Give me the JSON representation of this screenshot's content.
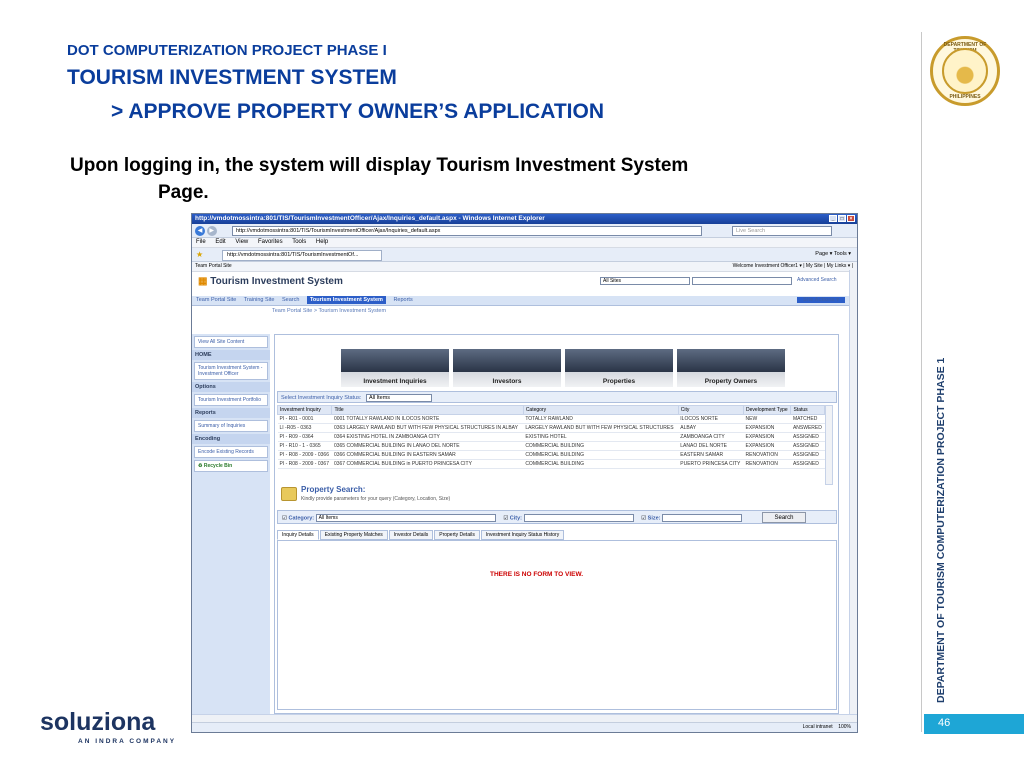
{
  "slide": {
    "heading1": "DOT COMPUTERIZATION PROJECT PHASE I",
    "heading2": "TOURISM INVESTMENT SYSTEM",
    "heading3": "> APPROVE PROPERTY OWNER’S APPLICATION",
    "intro_line1": "Upon logging in, the system will display Tourism Investment System",
    "intro_line2": "Page.",
    "side_text": "DEPARTMENT OF TOURISM COMPUTERIZATION PROJECT PHASE 1",
    "page_number": "46",
    "logo": "soluziona",
    "logo_sub": "AN INDRA COMPANY",
    "seal_top": "DEPARTMENT OF TOURISM",
    "seal_bottom": "PHILIPPINES"
  },
  "browser": {
    "title": "http://vmdotmossintra:801/TIS/TourismInvestmentOfficer/Ajax/Inquiries_default.aspx - Windows Internet Explorer",
    "url": "http://vmdotmossintra:801/TIS/TourismInvestmentOfficer/Ajax/Inquiries_default.aspx",
    "live_search": "Live Search",
    "menu": [
      "File",
      "Edit",
      "View",
      "Favorites",
      "Tools",
      "Help"
    ],
    "tab": "http://vmdotmossintra:801/TIS/TourismInvestmentOf...",
    "tools_right": "Page ▾   Tools ▾",
    "status_zone": "Local intranet",
    "zoom": "100%"
  },
  "sharepoint": {
    "site": "Team Portal Site",
    "welcome": "Welcome Investment Officer1 ▾ | My Site | My Links ▾ |",
    "title": "Tourism Investment System",
    "all_sites": "All Sites",
    "advanced_search": "Advanced Search",
    "nav": [
      "Team Portal Site",
      "Training Site",
      "Search",
      "Tourism Investment System",
      "Reports"
    ],
    "site_actions": "Site Actions ▾",
    "breadcrumb": "Team Portal Site > Tourism Investment System"
  },
  "leftnav": {
    "view_all": "View All Site Content",
    "home": "HOME",
    "home_item": "Tourism Investment System - Investment Officer",
    "options": "Options",
    "options_item": "Tourism Investment Portfolio",
    "reports": "Reports",
    "reports_item": "Summary of Inquiries",
    "encoding": "Encoding",
    "encoding_item": "Encode Existing Records",
    "recycle": "Recycle Bin"
  },
  "tiles": [
    "Investment Inquiries",
    "Investors",
    "Properties",
    "Property Owners"
  ],
  "status_select": {
    "label": "Select Investment Inquiry Status:",
    "value": "All Items"
  },
  "grid": {
    "headers": [
      "Investment Inquiry",
      "Title",
      "Category",
      "City",
      "Development Type",
      "Status"
    ],
    "rows": [
      [
        "PI - R01 - 0001",
        "0001 TOTALLY RAWLAND IN ILOCOS NORTE",
        "TOTALLY RAWLAND",
        "ILOCOS NORTE",
        "NEW",
        "MATCHED"
      ],
      [
        "LI -R05 - 0363",
        "0363 LARGELY RAWLAND BUT WITH FEW PHYSICAL STRUCTURES IN ALBAY",
        "LARGELY RAWLAND BUT WITH FEW PHYSICAL STRUCTURES",
        "ALBAY",
        "EXPANSION",
        "ANSWERED"
      ],
      [
        "PI - R09 - 0364",
        "0364 EXISTING HOTEL IN ZAMBOANGA CITY",
        "EXISTING HOTEL",
        "ZAMBOANGA CITY",
        "EXPANSION",
        "ASSIGNED"
      ],
      [
        "PI - R10 - 1 - 0365",
        "0365 COMMERCIAL BUILDING IN LANAO DEL NORTE",
        "COMMERCIAL BUILDING",
        "LANAO DEL NORTE",
        "EXPANSION",
        "ASSIGNED"
      ],
      [
        "PI - R08 - 2009 - 0366",
        "0366 COMMERCIAL BUILDING IN EASTERN SAMAR",
        "COMMERCIAL BUILDING",
        "EASTERN SAMAR",
        "RENOVATION",
        "ASSIGNED"
      ],
      [
        "PI - R08 - 2009 - 0367",
        "0367 COMMERCIAL BUILDING in PUERTO PRINCESA CITY",
        "COMMERCIAL BUILDING",
        "PUERTO PRINCESA CITY",
        "RENOVATION",
        "ASSIGNED"
      ]
    ]
  },
  "property_search": {
    "title": "Property Search:",
    "subtitle": "Kindly provide parameters for your query (Category, Location, Size)",
    "category_label": "Category:",
    "category_value": "All Items",
    "city_label": "City:",
    "size_label": "Size:",
    "search_button": "Search"
  },
  "detail_tabs": [
    "Inquiry Details",
    "Existing Property Matches",
    "Investor Details",
    "Property Details",
    "Investment Inquiry Status History"
  ],
  "no_form": "THERE IS NO FORM TO VIEW."
}
